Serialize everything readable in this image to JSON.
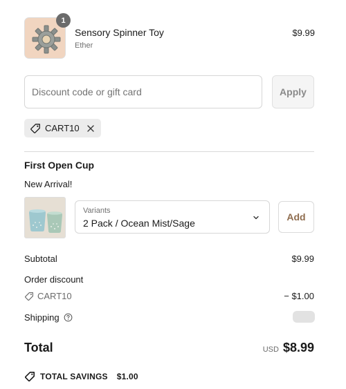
{
  "cart_item": {
    "quantity": "1",
    "title": "Sensory Spinner Toy",
    "variant": "Ether",
    "price": "$9.99",
    "image_icon": "spinner-toy-image"
  },
  "discount": {
    "placeholder": "Discount code or gift card",
    "value": "",
    "apply_label": "Apply",
    "applied_code": "CART10"
  },
  "upsell": {
    "title": "First Open Cup",
    "subtitle": "New Arrival!",
    "image_icon": "cups-image",
    "variant_label": "Variants",
    "variant_value": "2 Pack / Ocean Mist/Sage",
    "add_label": "Add"
  },
  "summary": {
    "subtotal_label": "Subtotal",
    "subtotal_value": "$9.99",
    "order_discount_label": "Order discount",
    "discount_code": "CART10",
    "discount_value": "− $1.00",
    "shipping_label": "Shipping",
    "total_label": "Total",
    "currency": "USD",
    "total_value": "$8.99",
    "savings_label": "TOTAL SAVINGS",
    "savings_value": "$1.00"
  }
}
